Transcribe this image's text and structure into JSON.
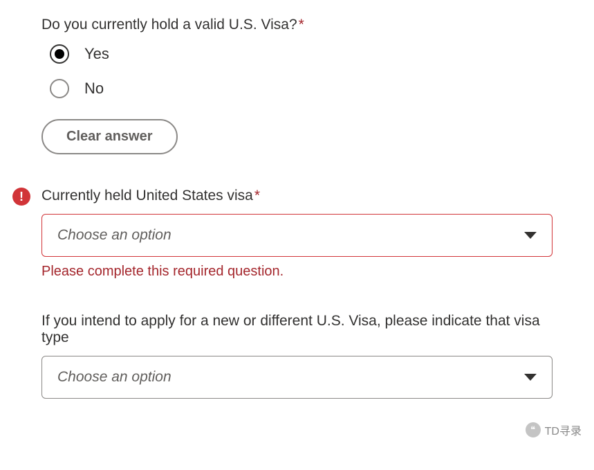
{
  "q1": {
    "label": "Do you currently hold a valid U.S. Visa?",
    "required": true,
    "options": {
      "yes": "Yes",
      "no": "No"
    },
    "selected": "yes",
    "clear_label": "Clear answer"
  },
  "q2": {
    "label": "Currently held United States visa",
    "required": true,
    "placeholder": "Choose an option",
    "has_error": true,
    "error_message": "Please complete this required question."
  },
  "q3": {
    "label": "If you intend to apply for a new or different U.S. Visa, please indicate that visa type",
    "required": false,
    "placeholder": "Choose an option"
  },
  "watermark": {
    "text": "TD寻录"
  }
}
